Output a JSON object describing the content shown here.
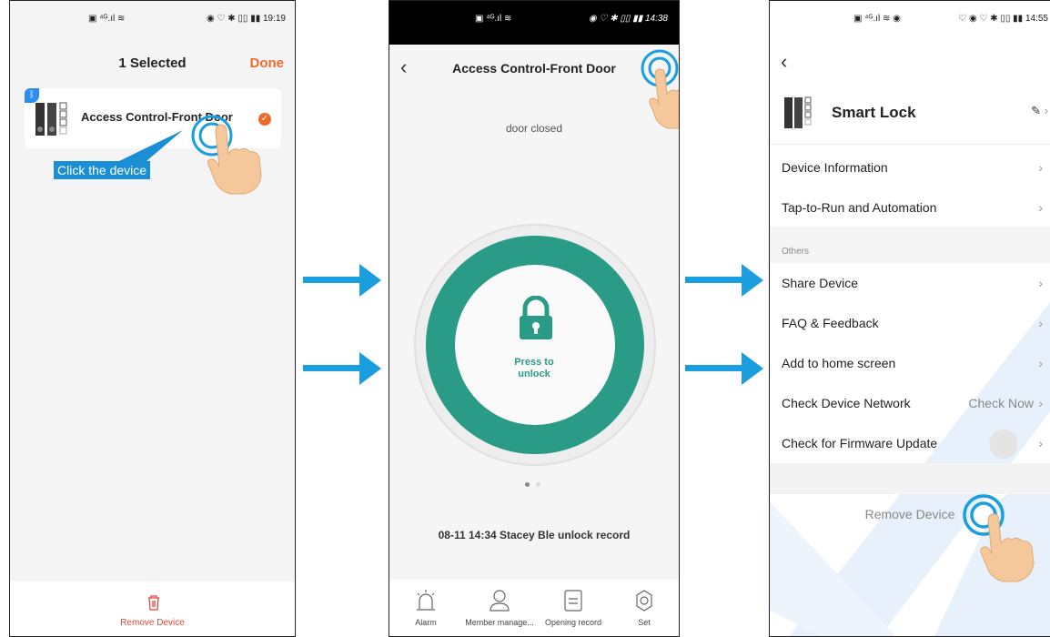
{
  "screen1": {
    "status_right": "◉ ♡ ✱ ▯▯ ▮▮ 19:19",
    "title": "1 Selected",
    "done_label": "Done",
    "device_name": "Access Control-Front Door",
    "tooltip": "Click the device",
    "remove_label": "Remove Device"
  },
  "screen2": {
    "status_right": "◉ ♡ ✱ ▯▯ ▮▮ 14:38",
    "title": "Access Control-Front Door",
    "door_status": "door closed",
    "press_label_1": "Press to",
    "press_label_2": "unlock",
    "record": "08-11 14:34 Stacey Ble unlock record",
    "tabs": [
      {
        "label": "Alarm",
        "icon": "alarm-icon"
      },
      {
        "label": "Member manage...",
        "icon": "member-icon"
      },
      {
        "label": "Opening record",
        "icon": "record-icon"
      },
      {
        "label": "Set",
        "icon": "settings-icon"
      }
    ]
  },
  "screen3": {
    "status_right": "♡ ◉ ♡ ✱ ▯▯ ▮▮ 14:55",
    "device_title": "Smart Lock",
    "items": [
      {
        "label": "Device Information"
      },
      {
        "label": "Tap-to-Run and Automation"
      }
    ],
    "section_label": "Others",
    "others": [
      {
        "label": "Share Device"
      },
      {
        "label": "FAQ & Feedback"
      },
      {
        "label": "Add to home screen"
      },
      {
        "label": "Check Device Network",
        "value": "Check Now"
      },
      {
        "label": "Check for Firmware Update"
      }
    ],
    "remove_label": "Remove Device"
  },
  "colors": {
    "accent_orange": "#ee6a2b",
    "teal": "#2a9b87",
    "arrow_blue": "#1a9ee0",
    "tooltip_blue": "#1a8fd6",
    "remove_red": "#e2473f"
  }
}
